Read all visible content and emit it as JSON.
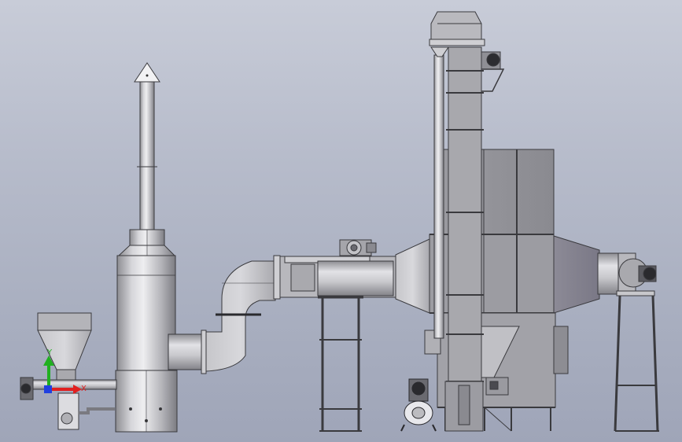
{
  "view": {
    "background_top": "#c8ccd8",
    "background_bottom": "#9fa5b8",
    "metal_light": "#e4e4e6",
    "metal_mid": "#b8b8bc",
    "metal_dark": "#8a8a90",
    "outline": "#3a3a3e"
  },
  "triad": {
    "x_label": "X",
    "y_label": "Y",
    "x_color": "#e02020",
    "y_color": "#20b020",
    "z_color": "#2040e0"
  }
}
